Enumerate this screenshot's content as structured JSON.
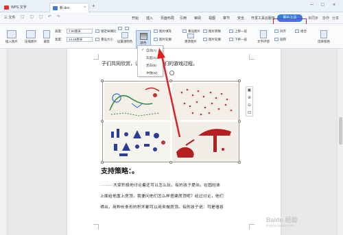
{
  "titlebar": {
    "app_tab": "WPS 文字",
    "doc_tab": "新.doc",
    "close_glyph": "×",
    "add_glyph": "+",
    "win_min": "─",
    "win_max": "□",
    "win_close": "×"
  },
  "menubar": {
    "file_label": "三 文件",
    "quick_icons": "▢ ▢ ▢ ↶ ↷",
    "items": [
      "开始",
      "插入",
      "页面布局",
      "引用",
      "审阅",
      "视图",
      "章节",
      "安全",
      "开发工具",
      "云服务"
    ],
    "active_item": "图片工具",
    "right_items": [
      "未同步",
      "协作",
      "分享",
      "⋮",
      "?",
      "∧"
    ]
  },
  "toolbar": {
    "insert_picture": "插入图片",
    "compress_picture": "压缩图片",
    "crop": "裁剪",
    "height_label": "高度:",
    "height_value": "7.99厘米",
    "width_label": "宽度:",
    "width_value": "14.16厘米",
    "lock_ratio": "锁定纵横比",
    "reset_size": "重设大小",
    "brightness_up": "增加对比度",
    "brightness_down": "降低对比度",
    "increase_brightness": "增加亮度",
    "reduce_brightness": "降低亮度",
    "set_transparent": "设置透明色",
    "color": "颜色",
    "picture_fill": "图片填充",
    "picture_outline": "图片轮廓",
    "picture_effect": "图片效果",
    "reset_picture": "重设图片",
    "change_picture": "更改图片",
    "align": "对齐",
    "rotate": "旋转",
    "select_pane": "选择窗格",
    "wrap_text": "文字环绕",
    "group": "组合",
    "bring_forward": "上移一层",
    "send_backward": "下移一层",
    "picture_transform": "图片转换",
    "picture_outline2": "图片轮廓"
  },
  "color_menu": {
    "items": [
      {
        "label": "自动(A)",
        "checked": true
      },
      {
        "label": "灰度(G)",
        "checked": false
      },
      {
        "label": "黑白(B)",
        "checked": false
      },
      {
        "label": "冲蚀(W)",
        "checked": false
      }
    ],
    "check_glyph": "✓"
  },
  "document": {
    "top_line": "子们共同欣赏，让……出了他们的游戏过程。",
    "heading": "支持策略：。",
    "paragraphs": [
      "·········大家积极地讨论着还可以怎么玩，有的孩子提出，在圆柱体",
      "上面给他盖上房顶，我便问他们怎么样搭建房顶呢？经过讨论，他们",
      "得出，用种长条形的积木都可以用来做房顶。有的孩子说：可是墙容"
    ]
  },
  "side_tools": [
    "▣",
    "⊕",
    "⊖",
    "⊡"
  ],
  "watermark": {
    "brand": "Baidu 经验",
    "sub": "jingyan.baidu.com"
  },
  "colors": {
    "accent": "#3b7be0",
    "highlight": "#e02020"
  }
}
